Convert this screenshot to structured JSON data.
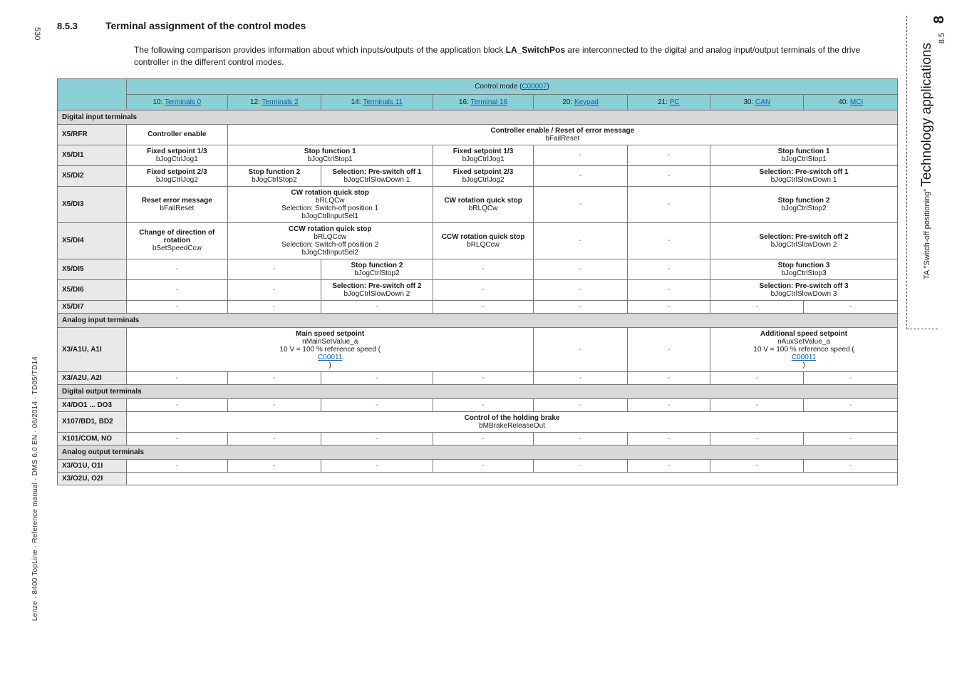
{
  "page": {
    "left_num": "530",
    "footer": "Lenze · 8400 TopLine · Reference manual · DMS 6.0 EN · 06/2014 · TD05/TD14",
    "right_chapter_num": "8",
    "right_section_num": "8.5",
    "right_title": "Technology applications",
    "right_sub": "TA \"Switch-off positioning\""
  },
  "heading": {
    "num": "8.5.3",
    "title": "Terminal assignment of the control modes"
  },
  "intro": "The following comparison provides information about which inputs/outputs of the application block LA_SwitchPos are interconnected to the digital and analog input/output terminals of the drive controller in the different control modes.",
  "intro_bold": "LA_SwitchPos",
  "header": {
    "top": "Control mode (C00007)",
    "top_link": "C00007",
    "cols": [
      {
        "num": "10:",
        "label": "Terminals 0"
      },
      {
        "num": "12:",
        "label": "Terminals 2"
      },
      {
        "num": "14:",
        "label": "Terminals 11"
      },
      {
        "num": "16:",
        "label": "Terminal 16"
      },
      {
        "num": "20:",
        "label": "Keypad"
      },
      {
        "num": "21:",
        "label": "PC"
      },
      {
        "num": "30:",
        "label": "CAN"
      },
      {
        "num": "40:",
        "label": "MCI"
      }
    ]
  },
  "sections": {
    "dig_in": "Digital input terminals",
    "ana_in": "Analog input terminals",
    "dig_out": "Digital output terminals",
    "ana_out": "Analog output terminals"
  },
  "rows": {
    "rfr": {
      "label": "X5/RFR",
      "c1": {
        "b": "Controller enable",
        "s": ""
      },
      "merge": {
        "b": "Controller enable / Reset of error message",
        "s": "bFailReset"
      }
    },
    "di1": {
      "label": "X5/DI1",
      "c1": {
        "b": "Fixed setpoint 1/3",
        "s": "bJogCtrlJog1"
      },
      "c2": {
        "b": "Stop function 1",
        "s": "bJogCtrlStop1"
      },
      "c3": {
        "b": "Fixed setpoint 1/3",
        "s": "bJogCtrlJog1"
      },
      "c7": {
        "b": "Stop function 1",
        "s": "bJogCtrlStop1"
      }
    },
    "di2": {
      "label": "X5/DI2",
      "c1": {
        "b": "Fixed setpoint 2/3",
        "s": "bJogCtrlJog2"
      },
      "c2a": {
        "b": "Stop function 2",
        "s": "bJogCtrlStop2"
      },
      "c2b": {
        "b": "Selection: Pre-switch off 1",
        "s": "bJogCtrlSlowDown 1"
      },
      "c3": {
        "b": "Fixed setpoint 2/3",
        "s": "bJogCtrlJog2"
      },
      "c7": {
        "b": "Selection: Pre-switch off 1",
        "s": "bJogCtrlSlowDown 1"
      }
    },
    "di3": {
      "label": "X5/DI3",
      "c1": {
        "b": "Reset error message",
        "s": "bFailReset"
      },
      "c2": {
        "b": "CW rotation quick stop",
        "s": "bRLQCw",
        "s2": "Selection: Switch-off position 1",
        "s3": "bJogCtrlInputSel1"
      },
      "c3": {
        "b": "CW rotation quick stop",
        "s": "bRLQCw"
      },
      "c7": {
        "b": "Stop function 2",
        "s": "bJogCtrlStop2"
      }
    },
    "di4": {
      "label": "X5/DI4",
      "c1": {
        "b": "Change of direction of rotation",
        "s": "bSetSpeedCcw"
      },
      "c2": {
        "b": "CCW rotation quick stop",
        "s": "bRLQCcw",
        "s2": "Selection: Switch-off position 2",
        "s3": "bJogCtrlInputSel2"
      },
      "c3": {
        "b": "CCW rotation quick stop",
        "s": "bRLQCcw"
      },
      "c7": {
        "b": "Selection: Pre-switch off 2",
        "s": "bJogCtrlSlowDown 2"
      }
    },
    "di5": {
      "label": "X5/DI5",
      "c2": {
        "b": "Stop function 2",
        "s": "bJogCtrlStop2"
      },
      "c7": {
        "b": "Stop function 3",
        "s": "bJogCtrlStop3"
      }
    },
    "di6": {
      "label": "X5/DI6",
      "c2": {
        "b": "Selection: Pre-switch off 2",
        "s": "bJogCtrlSlowDown 2"
      },
      "c7": {
        "b": "Selection: Pre-switch off 3",
        "s": "bJogCtrlSlowDown 3"
      }
    },
    "di7": {
      "label": "X5/DI7"
    },
    "a1u": {
      "label": "X3/A1U, A1I",
      "main": {
        "b": "Main speed setpoint",
        "s": "nMainSetValue_a",
        "s2": "10 V = 100 % reference speed (",
        "link": "C00011",
        "s3": ")"
      },
      "add": {
        "b": "Additional speed setpoint",
        "s": "nAuxSetValue_a",
        "s2": "10 V = 100 % reference speed (",
        "link": "C00011",
        "s3": ")"
      }
    },
    "a2u": {
      "label": "X3/A2U, A2I"
    },
    "do1": {
      "label": "X4/DO1 ... DO3"
    },
    "bd2": {
      "label": "X107/BD1, BD2",
      "merge": {
        "b": "Control of the holding brake",
        "s": "bMBrakeReleaseOut"
      }
    },
    "com": {
      "label": "X101/COM, NO"
    },
    "o1u": {
      "label": "X3/O1U, O1I"
    },
    "o2u": {
      "label": "X3/O2U, O2I"
    }
  }
}
